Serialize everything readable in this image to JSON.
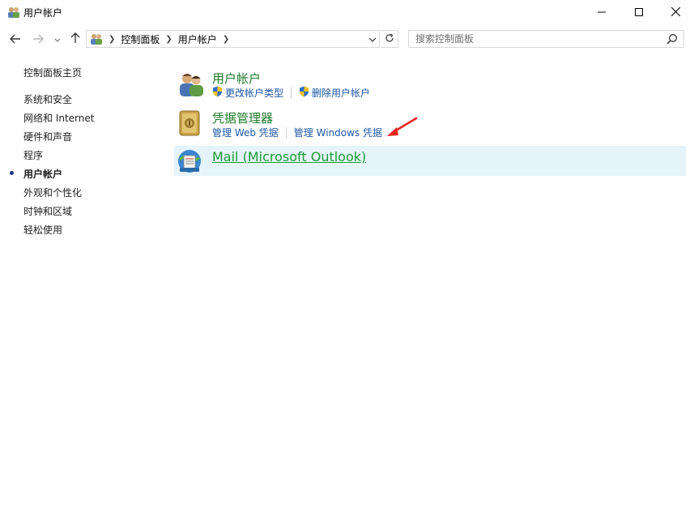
{
  "window": {
    "title": "用户帐户",
    "controls": {
      "minimize": "minimize-icon",
      "maximize": "maximize-icon",
      "close": "close-icon"
    }
  },
  "address_bar": {
    "breadcrumbs": [
      "控制面板",
      "用户帐户"
    ],
    "icon": "user-accounts-icon"
  },
  "search": {
    "placeholder": "搜索控制面板"
  },
  "sidebar": {
    "items": [
      {
        "label": "控制面板主页",
        "active": false
      },
      {
        "label": "系统和安全",
        "active": false
      },
      {
        "label": "网络和 Internet",
        "active": false
      },
      {
        "label": "硬件和声音",
        "active": false
      },
      {
        "label": "程序",
        "active": false
      },
      {
        "label": "用户帐户",
        "active": true
      },
      {
        "label": "外观和个性化",
        "active": false
      },
      {
        "label": "时钟和区域",
        "active": false
      },
      {
        "label": "轻松使用",
        "active": false
      }
    ]
  },
  "main": {
    "categories": [
      {
        "title": "用户帐户",
        "icon": "user-accounts-icon",
        "links": [
          {
            "label": "更改帐户类型",
            "icon": "uac-shield-icon"
          },
          {
            "label": "删除用户帐户",
            "icon": "uac-shield-icon"
          }
        ]
      },
      {
        "title": "凭据管理器",
        "icon": "credential-manager-icon",
        "links": [
          {
            "label": "管理 Web 凭据"
          },
          {
            "label": "管理 Windows 凭据"
          }
        ]
      },
      {
        "title": "Mail (Microsoft Outlook)",
        "icon": "mail-icon",
        "highlighted": true
      }
    ]
  },
  "colors": {
    "category_title": "#1e7a2a",
    "link": "#1c57a5",
    "highlight_bg": "#e5f3fb",
    "annotation_arrow": "#e8231e"
  }
}
